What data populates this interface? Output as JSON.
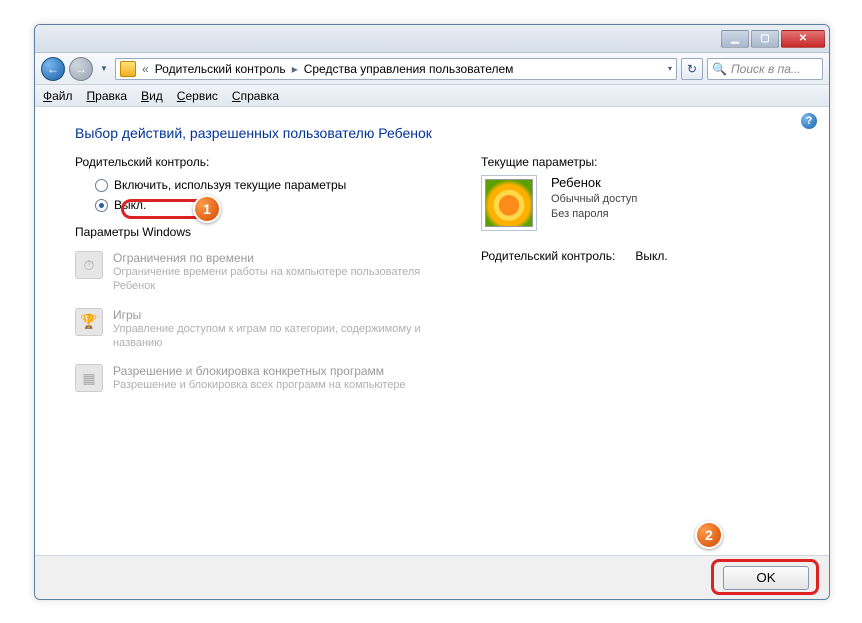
{
  "window_controls": {
    "min": "▁",
    "max": "▢",
    "close": "✕"
  },
  "nav": {
    "back": "←",
    "forward": "→",
    "dropdown": "▼"
  },
  "breadcrumb": {
    "chevron": "«",
    "seg1": "Родительский контроль",
    "sep": "▸",
    "seg2": "Средства управления пользователем",
    "drop": "▾"
  },
  "refresh_icon": "↻",
  "search": {
    "icon": "🔍",
    "placeholder": "Поиск в па..."
  },
  "menu": {
    "file": "Файл",
    "edit": "Правка",
    "view": "Вид",
    "tools": "Сервис",
    "help": "Справка"
  },
  "help_icon": "?",
  "page_title": "Выбор действий, разрешенных пользователю Ребенок",
  "left": {
    "section_label": "Родительский контроль:",
    "radio_on": "Включить, используя текущие параметры",
    "radio_off": "Выкл.",
    "params_header": "Параметры Windows",
    "time": {
      "title": "Ограничения по времени",
      "desc": "Ограничение времени работы на компьютере пользователя Ребенок"
    },
    "games": {
      "title": "Игры",
      "desc": "Управление доступом к играм по категории, содержимому и названию"
    },
    "programs": {
      "title": "Разрешение и блокировка конкретных программ",
      "desc": "Разрешение и блокировка всех программ на компьютере"
    }
  },
  "right": {
    "section_label": "Текущие параметры:",
    "user_name": "Ребенок",
    "access": "Обычный доступ",
    "password": "Без пароля",
    "pc_label": "Родительский контроль:",
    "pc_value": "Выкл."
  },
  "badges": {
    "one": "1",
    "two": "2"
  },
  "footer": {
    "ok": "OK"
  },
  "icons": {
    "clock": "⏱",
    "trophy": "🏆",
    "box": "▦"
  }
}
